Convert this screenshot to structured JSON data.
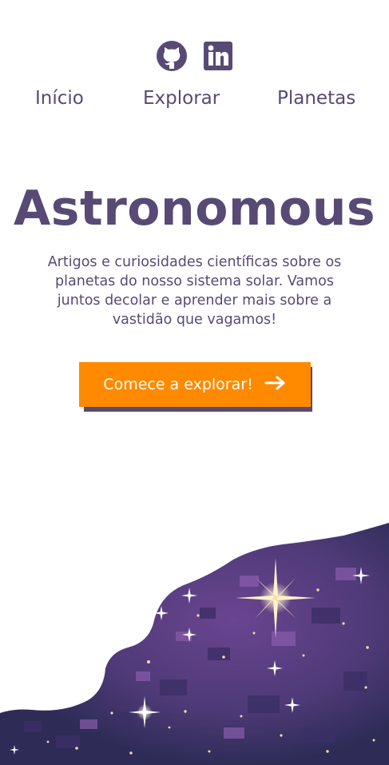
{
  "header": {
    "socials": [
      {
        "name": "github-icon"
      },
      {
        "name": "linkedin-icon"
      }
    ],
    "nav": [
      "Início",
      "Explorar",
      "Planetas"
    ]
  },
  "hero": {
    "title": "Astronomous",
    "description": "Artigos e curiosidades científicas sobre os planetas do nosso sistema solar. Vamos juntos decolar e aprender mais sobre a vastidão que vagamos!",
    "cta_label": "Comece a explorar!",
    "cta_icon": "arrow-right-icon"
  },
  "colors": {
    "primary": "#574a74",
    "accent": "#ff8a00",
    "space_dark": "#2e2c57",
    "space_purple": "#5a3b7f"
  }
}
